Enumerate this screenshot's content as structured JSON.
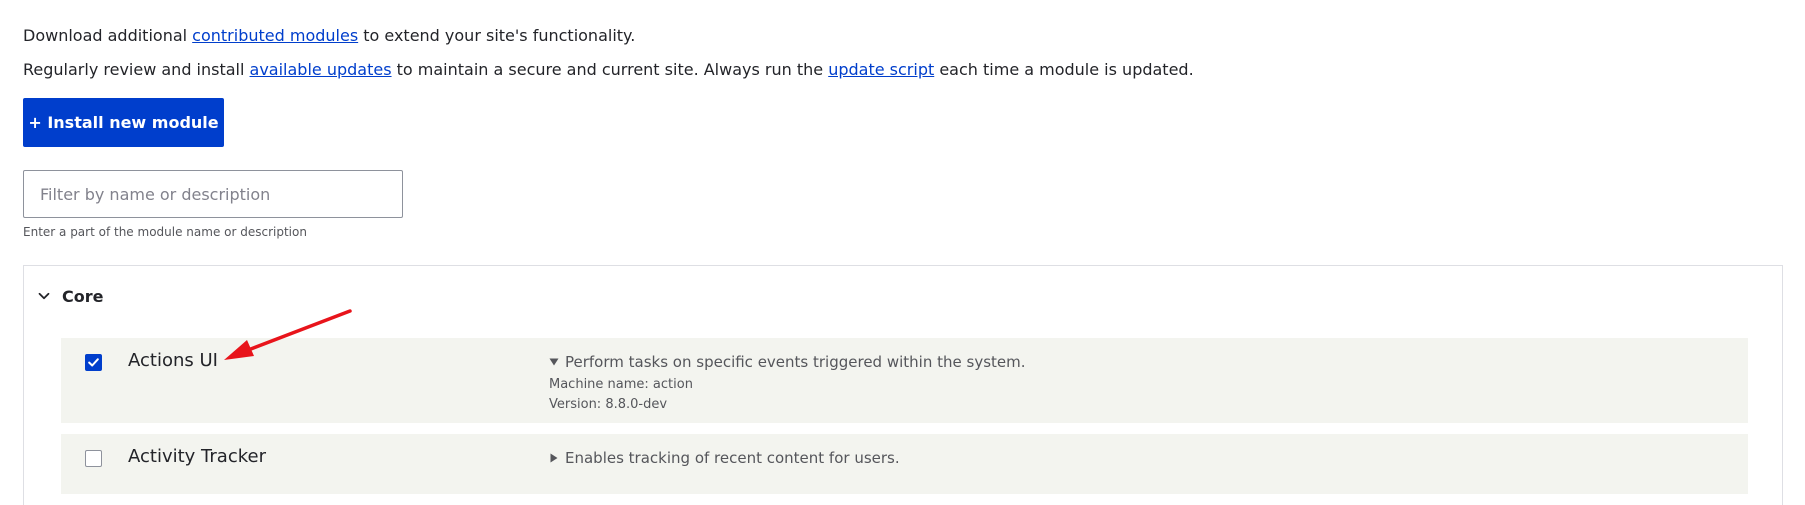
{
  "intro": {
    "line1": {
      "before": "Download additional ",
      "link": "contributed modules",
      "after": " to extend your site's functionality."
    },
    "line2": {
      "before": "Regularly review and install ",
      "link1": "available updates",
      "middle": " to maintain a secure and current site. Always run the ",
      "link2": "update script",
      "after": " each time a module is updated."
    }
  },
  "install_button": {
    "label": "+ Install new module"
  },
  "filter": {
    "placeholder": "Filter by name or description",
    "value": "",
    "help": "Enter a part of the module name or description"
  },
  "core_group": {
    "title": "Core",
    "modules": [
      {
        "name": "Actions UI",
        "checked": true,
        "expanded": true,
        "description": "Perform tasks on specific events triggered within the system.",
        "machine_name": "Machine name: action",
        "version": "Version: 8.8.0-dev"
      },
      {
        "name": "Activity Tracker",
        "checked": false,
        "expanded": false,
        "description": "Enables tracking of recent content for users."
      }
    ]
  },
  "colors": {
    "accent": "#003ecc",
    "row_background": "#f3f4ef",
    "annotation_arrow": "#e8141b"
  },
  "icons": {
    "chevron": "chevron-down-icon",
    "expanded_triangle": "triangle-down-icon",
    "collapsed_triangle": "triangle-right-icon",
    "checkmark": "checkmark-icon"
  }
}
